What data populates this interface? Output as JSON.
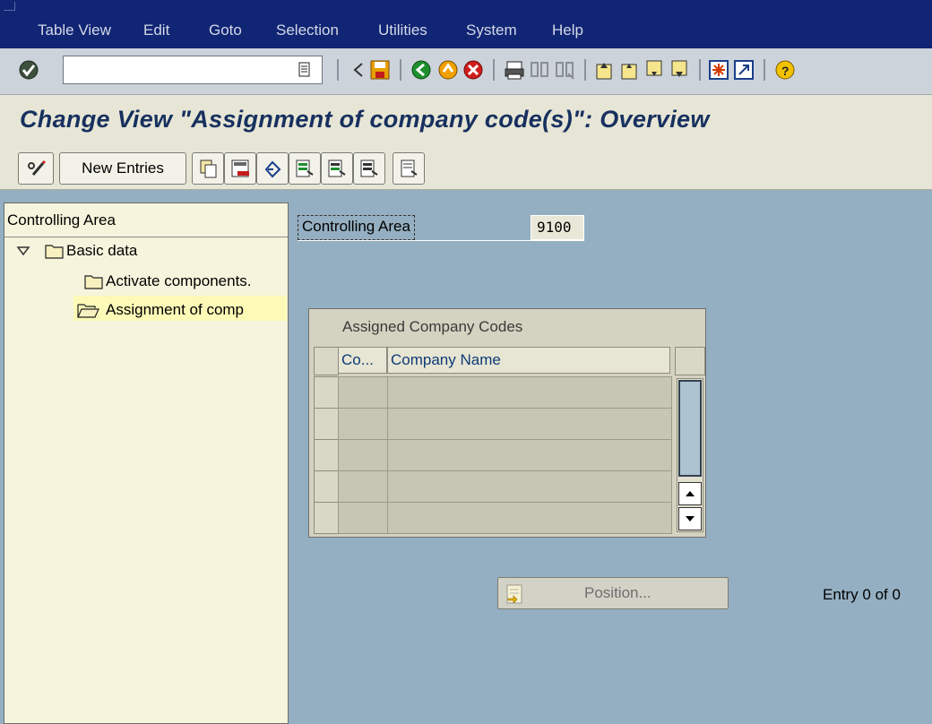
{
  "menu": {
    "items": [
      "Table View",
      "Edit",
      "Goto",
      "Selection",
      "Utilities",
      "System",
      "Help"
    ]
  },
  "page": {
    "title": "Change View \"Assignment of company code(s)\": Overview"
  },
  "app_toolbar": {
    "new_entries_label": "New Entries"
  },
  "nav_tree": {
    "header": "Controlling Area",
    "items": [
      "Basic data",
      "Activate components.",
      "Assignment of comp"
    ]
  },
  "form": {
    "controlling_area_label": "Controlling Area",
    "controlling_area_value": "9100"
  },
  "table": {
    "title": "Assigned Company Codes",
    "columns": [
      "Co...",
      "Company Name"
    ],
    "rows": 5
  },
  "footer": {
    "position_label": "Position...",
    "entry_text": "Entry 0 of 0"
  }
}
